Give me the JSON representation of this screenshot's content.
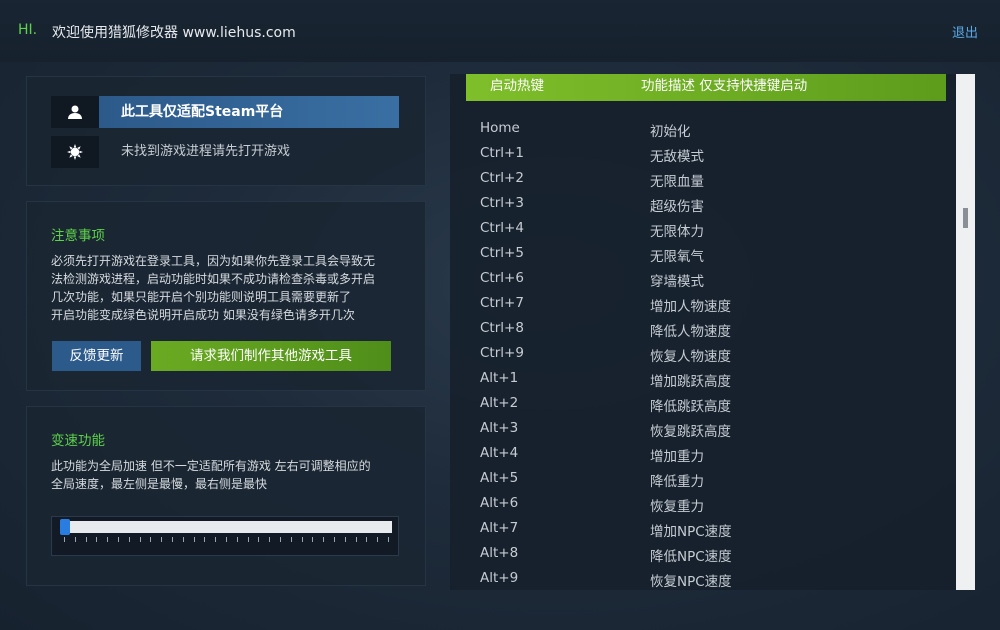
{
  "header": {
    "hi": "HI.",
    "welcome": "欢迎使用猎狐修改器 www.liehus.com",
    "logout": "退出"
  },
  "status": {
    "platform": "此工具仅适配Steam平台",
    "process": "未找到游戏进程请先打开游戏",
    "platform_icon": "user-icon",
    "process_icon": "gear-icon"
  },
  "notes": {
    "title": "注意事项",
    "lines": [
      "必须先打开游戏在登录工具，因为如果你先登录工具会导致无",
      "法检测游戏进程，启动功能时如果不成功请检查杀毒或多开启",
      "几次功能，如果只能开启个别功能则说明工具需要更新了",
      "开启功能变成绿色说明开启成功 如果没有绿色请多开几次"
    ],
    "feedback_button": "反馈更新",
    "request_button": "请求我们制作其他游戏工具"
  },
  "speed": {
    "title": "变速功能",
    "lines": [
      "此功能为全局加速 但不一定适配所有游戏 左右可调整相应的",
      "全局速度，最左侧是最慢，最右侧是最快"
    ],
    "slider_value_fraction": 0.0
  },
  "hotkeys": {
    "col_key": "启动热键",
    "col_desc": "功能描述 仅支持快捷键启动",
    "rows": [
      {
        "key": "Home",
        "desc": "初始化"
      },
      {
        "key": "Ctrl+1",
        "desc": "无敌模式"
      },
      {
        "key": "Ctrl+2",
        "desc": "无限血量"
      },
      {
        "key": "Ctrl+3",
        "desc": "超级伤害"
      },
      {
        "key": "Ctrl+4",
        "desc": "无限体力"
      },
      {
        "key": "Ctrl+5",
        "desc": "无限氧气"
      },
      {
        "key": "Ctrl+6",
        "desc": "穿墙模式"
      },
      {
        "key": "Ctrl+7",
        "desc": "增加人物速度"
      },
      {
        "key": "Ctrl+8",
        "desc": "降低人物速度"
      },
      {
        "key": "Ctrl+9",
        "desc": "恢复人物速度"
      },
      {
        "key": "Alt+1",
        "desc": "增加跳跃高度"
      },
      {
        "key": "Alt+2",
        "desc": "降低跳跃高度"
      },
      {
        "key": "Alt+3",
        "desc": "恢复跳跃高度"
      },
      {
        "key": "Alt+4",
        "desc": "增加重力"
      },
      {
        "key": "Alt+5",
        "desc": "降低重力"
      },
      {
        "key": "Alt+6",
        "desc": "恢复重力"
      },
      {
        "key": "Alt+7",
        "desc": "增加NPC速度"
      },
      {
        "key": "Alt+8",
        "desc": "降低NPC速度"
      },
      {
        "key": "Alt+9",
        "desc": "恢复NPC速度"
      }
    ]
  },
  "colors": {
    "accent_green": "#5dd24a",
    "accent_blue": "#2c5a8a",
    "link_blue": "#5aa8e6"
  }
}
